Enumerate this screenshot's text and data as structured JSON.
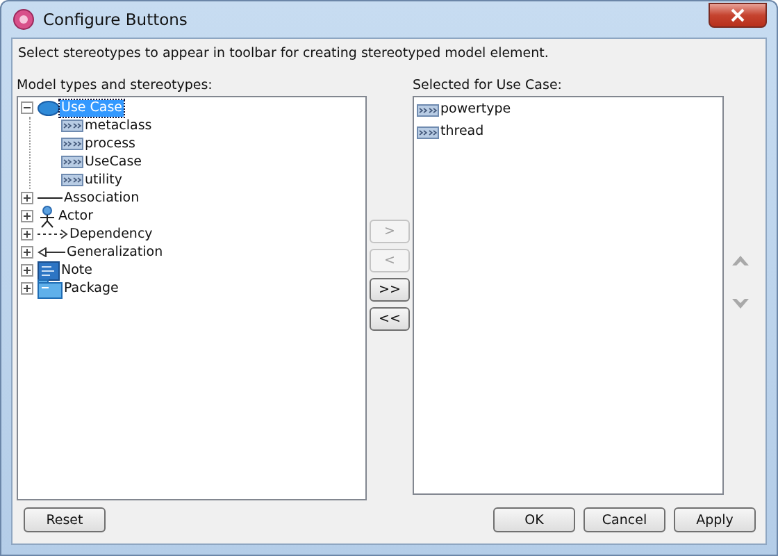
{
  "window": {
    "title": "Configure Buttons"
  },
  "instruction": "Select stereotypes to appear in toolbar for creating stereotyped model element.",
  "tree_label": "Model types and stereotypes:",
  "tree": [
    {
      "label": "Use Case",
      "kind": "usecase",
      "expanded": true,
      "selected": true,
      "children": [
        {
          "label": "metaclass",
          "kind": "stereotype",
          "selected": false
        },
        {
          "label": "process",
          "kind": "stereotype",
          "selected": false
        },
        {
          "label": "UseCase",
          "kind": "stereotype",
          "selected": false
        },
        {
          "label": "utility",
          "kind": "stereotype",
          "selected": false
        }
      ]
    },
    {
      "label": "Association",
      "kind": "association",
      "expanded": false,
      "selected": false
    },
    {
      "label": "Actor",
      "kind": "actor",
      "expanded": false,
      "selected": false
    },
    {
      "label": "Dependency",
      "kind": "dependency",
      "expanded": false,
      "selected": false
    },
    {
      "label": "Generalization",
      "kind": "generalization",
      "expanded": false,
      "selected": false
    },
    {
      "label": "Note",
      "kind": "note",
      "expanded": false,
      "selected": false
    },
    {
      "label": "Package",
      "kind": "package",
      "expanded": false,
      "selected": false
    }
  ],
  "move_buttons": [
    {
      "label": ">",
      "disabled": true
    },
    {
      "label": "<",
      "disabled": true
    },
    {
      "label": ">>",
      "disabled": false
    },
    {
      "label": "<<",
      "disabled": false
    }
  ],
  "selected_label": "Selected for Use Case:",
  "selected_list": [
    {
      "label": "powertype",
      "kind": "stereotype",
      "selected": false
    },
    {
      "label": "thread",
      "kind": "stereotype",
      "selected": false
    }
  ],
  "order_buttons": [
    {
      "kind": "up",
      "disabled": true
    },
    {
      "kind": "down",
      "disabled": true
    }
  ],
  "left_buttons": [
    "Reset"
  ],
  "right_buttons": [
    "OK",
    "Cancel",
    "Apply"
  ]
}
